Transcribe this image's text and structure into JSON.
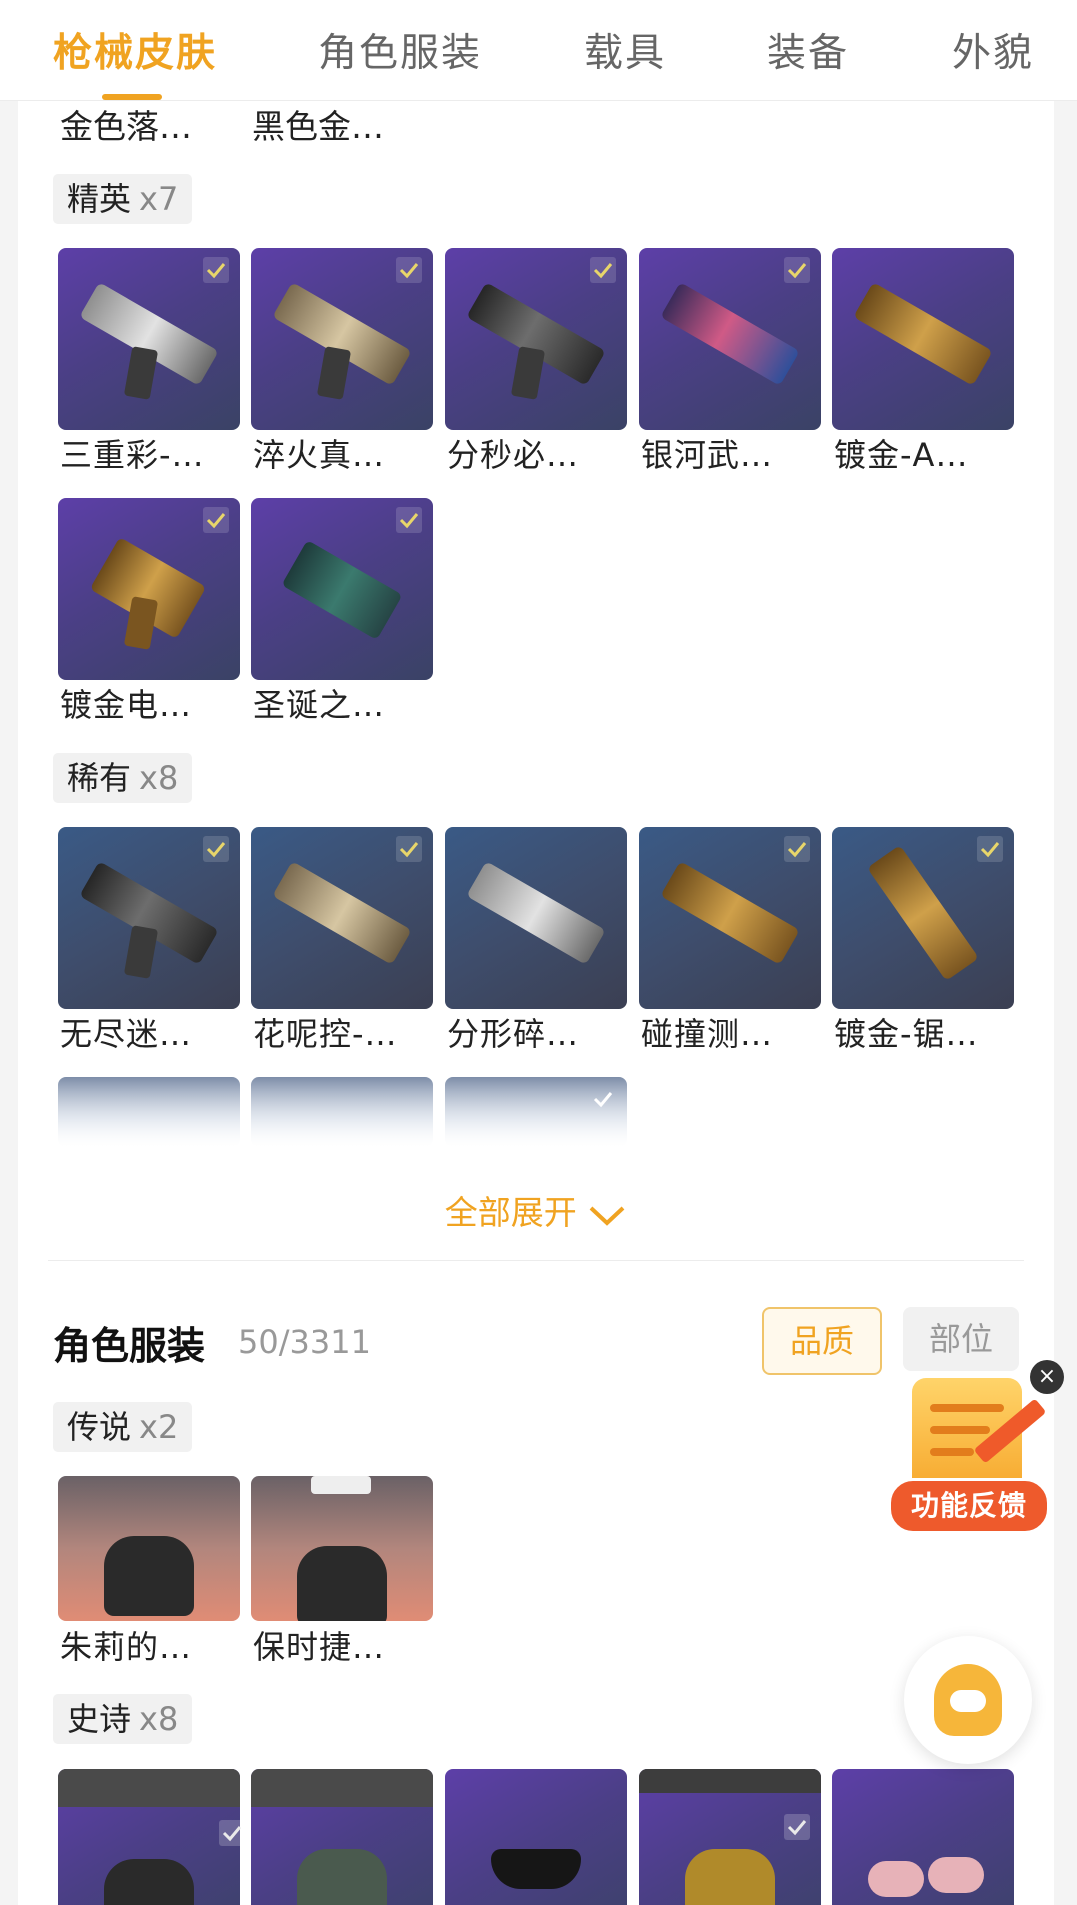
{
  "tabs": [
    {
      "label": "枪械皮肤",
      "active": true
    },
    {
      "label": "角色服装",
      "active": false
    },
    {
      "label": "载具",
      "active": false
    },
    {
      "label": "装备",
      "active": false
    },
    {
      "label": "外貌",
      "active": false
    }
  ],
  "partial_row": {
    "items": [
      "金色落…",
      "黑色金…"
    ]
  },
  "elite": {
    "tier": "精英",
    "count": "x7",
    "items": [
      "三重彩-…",
      "淬火真…",
      "分秒必…",
      "银河武…",
      "镀金-A…",
      "镀金电…",
      "圣诞之…"
    ]
  },
  "rare": {
    "tier": "稀有",
    "count": "x8",
    "items": [
      "无尽迷…",
      "花呢控-…",
      "分形碎…",
      "碰撞测…",
      "镀金-锯…"
    ]
  },
  "expand_all": "全部展开",
  "costume": {
    "title": "角色服装",
    "count": "50/3311",
    "filter_quality": "品质",
    "filter_part": "部位",
    "legend": {
      "tier": "传说",
      "count": "x2",
      "items": [
        "朱莉的…",
        "保时捷…"
      ]
    },
    "epic": {
      "tier": "史诗",
      "count": "x8"
    }
  },
  "feedback": {
    "label": "功能反馈",
    "close": "×"
  },
  "colors": {
    "accent": "#f0a321",
    "feedback": "#ee5a2c"
  },
  "icons": [
    "check-icon",
    "chevron-down-icon",
    "close-icon",
    "customer-service-icon",
    "feedback-icon"
  ]
}
